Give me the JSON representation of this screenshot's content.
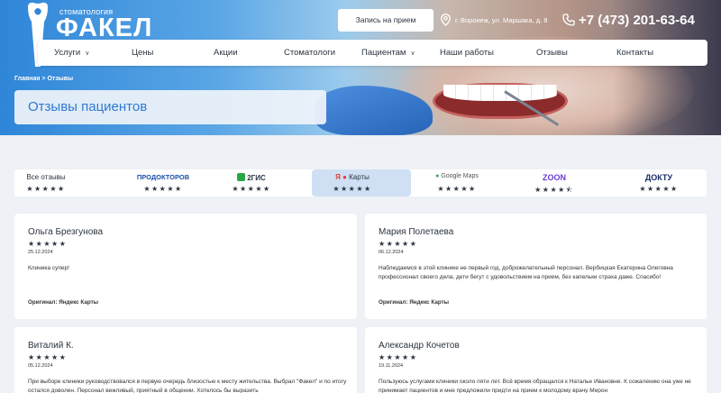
{
  "header": {
    "logo_small": "стоматология",
    "logo_big": "ФАКЕЛ",
    "cta_label": "Запись на прием",
    "address": "г. Воронеж, ул. Маршака, д. 8",
    "phone": "+7 (473) 201-63-64"
  },
  "nav": {
    "items": [
      "Услуги",
      "Цены",
      "Акции",
      "Стоматологи",
      "Пациентам",
      "Наши работы",
      "Отзывы",
      "Контакты"
    ]
  },
  "breadcrumb": "Главная > Отзывы",
  "page_title": "Отзывы пациентов",
  "sources": [
    {
      "label": "Все отзывы",
      "stars": "★★★★★",
      "active": false
    },
    {
      "label": "ПРОДОКТОРОВ",
      "stars": "★★★★★",
      "active": false
    },
    {
      "label": "2ГИС",
      "stars": "★★★★★",
      "active": false
    },
    {
      "label": "Карты",
      "stars": "★★★★★",
      "active": true
    },
    {
      "label": "Google Maps",
      "stars": "★★★★★",
      "active": false
    },
    {
      "label": "ZOON",
      "stars": "★★★★⯪",
      "active": false
    },
    {
      "label": "ДОКТУ",
      "stars": "★★★★★",
      "active": false
    }
  ],
  "reviews": [
    {
      "name": "Ольга Брезгунова",
      "stars": "★★★★★",
      "date": "25.12.2024",
      "text": "Клиника супер!",
      "origin": "Оригинал: Яндекс Карты"
    },
    {
      "name": "Мария Полетаева",
      "stars": "★★★★★",
      "date": "06.12.2024",
      "text": "Наблюдаемся в этой клинике не первый год, доброжелательный персонал. Вербицкая Екатерина Олеговна профессионал своего дела, дети бегут с удовольствием на прием, без капельки страха даже. Спасибо!",
      "origin": "Оригинал: Яндекс Карты"
    },
    {
      "name": "Виталий К.",
      "stars": "★★★★★",
      "date": "05.12.2024",
      "text": "При выборе клиники руководствовался в первую очередь близостью к месту жительства. Выбрал \"Факел\" и по итогу остался доволен. Персонал вежливый, приятный в общении. Хотелось бы выразить",
      "origin": ""
    },
    {
      "name": "Александр Кочетов",
      "stars": "★★★★★",
      "date": "19.11.2024",
      "text": "Пользуюсь услугами клиники около пяти лет. Всё время обращался к Наталье Ивановне. К сожалению она уже не принимает пациентов и мне предложили придти на прием к молодому врачу Мерон",
      "origin": ""
    }
  ],
  "colors": {
    "accent": "#2f7ad1",
    "active_tab": "#cfe0f4",
    "page_bg": "#eef1f6"
  }
}
